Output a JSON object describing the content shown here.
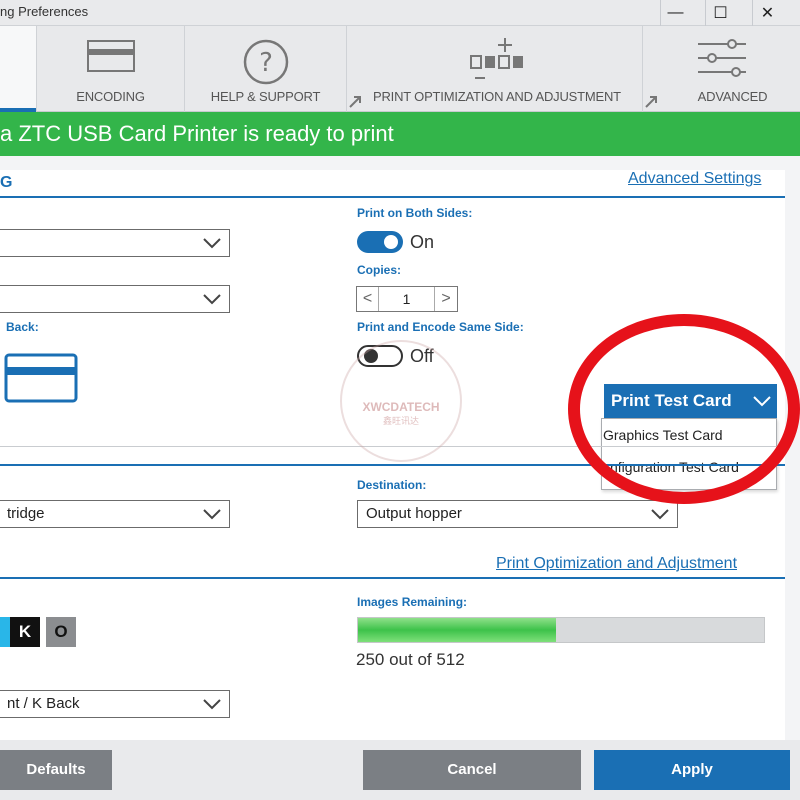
{
  "window": {
    "title": "ng Preferences",
    "controls": [
      "—",
      "☐",
      "✕"
    ]
  },
  "tabs": [
    {
      "label": "ENCODING",
      "icon": "card-icon"
    },
    {
      "label": "HELP & SUPPORT",
      "icon": "help-icon"
    },
    {
      "label": "PRINT OPTIMIZATION AND ADJUSTMENT",
      "icon": "optimization-icon"
    },
    {
      "label": "ADVANCED",
      "icon": "sliders-icon"
    }
  ],
  "status": {
    "text": "a ZTC USB Card Printer is ready to print",
    "color": "#33b54a"
  },
  "section1": {
    "title": "G",
    "advanced_link": "Advanced Settings",
    "back_label": "Back:"
  },
  "print_both_sides": {
    "label": "Print on Both Sides:",
    "value": "On"
  },
  "copies": {
    "label": "Copies:",
    "value": "1",
    "dec": "<",
    "inc": ">"
  },
  "same_side": {
    "label": "Print and Encode Same Side:",
    "value": "Off"
  },
  "print_test_card": {
    "button": "Print Test Card",
    "items": [
      "Graphics Test Card",
      "nfiguration Test Card"
    ]
  },
  "section2": {
    "source_value": "tridge",
    "destination_label": "Destination:",
    "destination_value": "Output hopper"
  },
  "section3": {
    "link": "Print Optimization and Adjustment",
    "ribbon_panels": [
      "K",
      "O"
    ],
    "images_label": "Images Remaining:",
    "images_text": "250 out of 512",
    "images_remaining": 250,
    "images_total": 512,
    "ribbon_select": "nt / K Back"
  },
  "buttons": {
    "defaults": "Defaults",
    "cancel": "Cancel",
    "apply": "Apply"
  },
  "watermark": {
    "brand": "XWCDATECH",
    "sub": "鑫旺讯达"
  },
  "colors": {
    "accent": "#1a6fb4",
    "status": "#33b54a",
    "highlight": "#e6121a"
  }
}
